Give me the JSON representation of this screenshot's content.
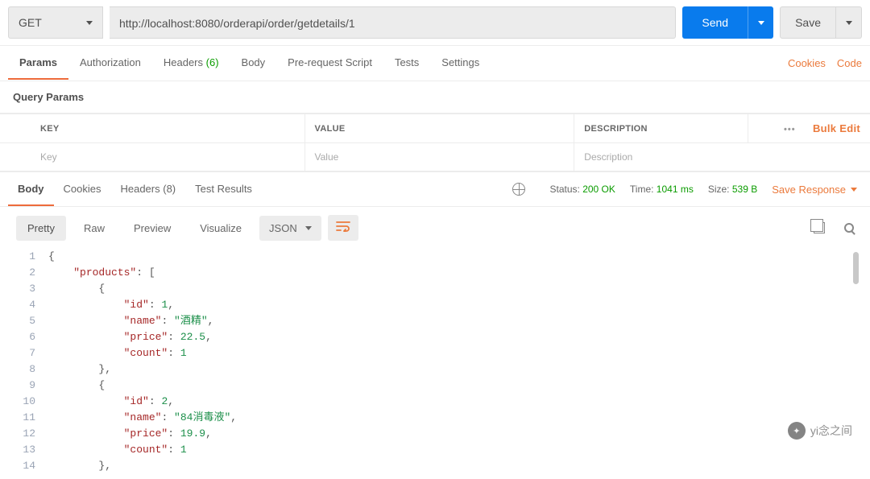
{
  "request": {
    "method": "GET",
    "url": "http://localhost:8080/orderapi/order/getdetails/1",
    "sendLabel": "Send",
    "saveLabel": "Save"
  },
  "reqTabs": {
    "params": "Params",
    "authorization": "Authorization",
    "headersLabel": "Headers",
    "headersCount": "(6)",
    "body": "Body",
    "prerequest": "Pre-request Script",
    "tests": "Tests",
    "settings": "Settings",
    "cookies": "Cookies",
    "code": "Code"
  },
  "queryParams": {
    "title": "Query Params",
    "columns": {
      "key": "KEY",
      "value": "VALUE",
      "description": "DESCRIPTION"
    },
    "placeholders": {
      "key": "Key",
      "value": "Value",
      "description": "Description"
    },
    "bulkEdit": "Bulk Edit"
  },
  "respTabs": {
    "body": "Body",
    "cookies": "Cookies",
    "headersLabel": "Headers",
    "headersCount": "(8)",
    "testResults": "Test Results"
  },
  "respMeta": {
    "statusLabel": "Status:",
    "statusValue": "200 OK",
    "timeLabel": "Time:",
    "timeValue": "1041 ms",
    "sizeLabel": "Size:",
    "sizeValue": "539 B",
    "saveResponse": "Save Response"
  },
  "viewer": {
    "pretty": "Pretty",
    "raw": "Raw",
    "preview": "Preview",
    "visualize": "Visualize",
    "format": "JSON"
  },
  "responseBody": {
    "products": [
      {
        "id": 1,
        "name": "酒精",
        "price": 22.5,
        "count": 1
      },
      {
        "id": 2,
        "name": "84消毒液",
        "price": 19.9,
        "count": 1
      }
    ]
  },
  "codeLines": [
    {
      "n": "1",
      "tokens": [
        {
          "t": "{",
          "c": "punct"
        }
      ]
    },
    {
      "n": "2",
      "indent": 1,
      "tokens": [
        {
          "t": "\"products\"",
          "c": "key"
        },
        {
          "t": ": [",
          "c": "punct"
        }
      ]
    },
    {
      "n": "3",
      "indent": 2,
      "tokens": [
        {
          "t": "{",
          "c": "punct"
        }
      ]
    },
    {
      "n": "4",
      "indent": 3,
      "tokens": [
        {
          "t": "\"id\"",
          "c": "key"
        },
        {
          "t": ": ",
          "c": "punct"
        },
        {
          "t": "1",
          "c": "num"
        },
        {
          "t": ",",
          "c": "punct"
        }
      ]
    },
    {
      "n": "5",
      "indent": 3,
      "tokens": [
        {
          "t": "\"name\"",
          "c": "key"
        },
        {
          "t": ": ",
          "c": "punct"
        },
        {
          "t": "\"酒精\"",
          "c": "str"
        },
        {
          "t": ",",
          "c": "punct"
        }
      ]
    },
    {
      "n": "6",
      "indent": 3,
      "tokens": [
        {
          "t": "\"price\"",
          "c": "key"
        },
        {
          "t": ": ",
          "c": "punct"
        },
        {
          "t": "22.5",
          "c": "num"
        },
        {
          "t": ",",
          "c": "punct"
        }
      ]
    },
    {
      "n": "7",
      "indent": 3,
      "tokens": [
        {
          "t": "\"count\"",
          "c": "key"
        },
        {
          "t": ": ",
          "c": "punct"
        },
        {
          "t": "1",
          "c": "num"
        }
      ]
    },
    {
      "n": "8",
      "indent": 2,
      "tokens": [
        {
          "t": "},",
          "c": "punct"
        }
      ]
    },
    {
      "n": "9",
      "indent": 2,
      "tokens": [
        {
          "t": "{",
          "c": "punct"
        }
      ]
    },
    {
      "n": "10",
      "indent": 3,
      "tokens": [
        {
          "t": "\"id\"",
          "c": "key"
        },
        {
          "t": ": ",
          "c": "punct"
        },
        {
          "t": "2",
          "c": "num"
        },
        {
          "t": ",",
          "c": "punct"
        }
      ]
    },
    {
      "n": "11",
      "indent": 3,
      "tokens": [
        {
          "t": "\"name\"",
          "c": "key"
        },
        {
          "t": ": ",
          "c": "punct"
        },
        {
          "t": "\"84消毒液\"",
          "c": "str"
        },
        {
          "t": ",",
          "c": "punct"
        }
      ]
    },
    {
      "n": "12",
      "indent": 3,
      "tokens": [
        {
          "t": "\"price\"",
          "c": "key"
        },
        {
          "t": ": ",
          "c": "punct"
        },
        {
          "t": "19.9",
          "c": "num"
        },
        {
          "t": ",",
          "c": "punct"
        }
      ]
    },
    {
      "n": "13",
      "indent": 3,
      "tokens": [
        {
          "t": "\"count\"",
          "c": "key"
        },
        {
          "t": ": ",
          "c": "punct"
        },
        {
          "t": "1",
          "c": "num"
        }
      ]
    },
    {
      "n": "14",
      "indent": 2,
      "tokens": [
        {
          "t": "},",
          "c": "punct"
        }
      ]
    }
  ],
  "watermark": "yi念之间"
}
